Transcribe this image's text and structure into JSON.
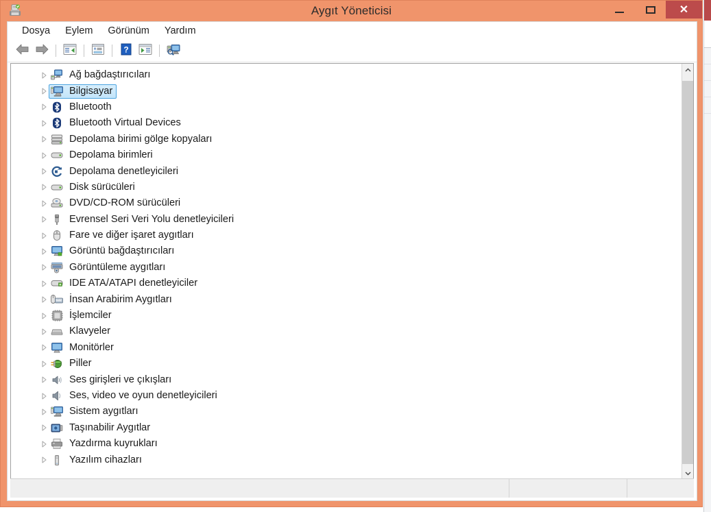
{
  "window": {
    "title": "Aygıt Yöneticisi",
    "app_icon": "device-manager-icon",
    "frame_color": "#f0946b",
    "close_button_color": "#bc4b4b",
    "controls": {
      "minimize_label": "—",
      "maximize_label": "❐",
      "close_label": "✕"
    }
  },
  "menu": {
    "items": [
      {
        "label": "Dosya",
        "name": "menu-dosya"
      },
      {
        "label": "Eylem",
        "name": "menu-eylem"
      },
      {
        "label": "Görünüm",
        "name": "menu-gorunum"
      },
      {
        "label": "Yardım",
        "name": "menu-yardim"
      }
    ]
  },
  "toolbar": {
    "buttons": [
      {
        "icon": "back-arrow-icon"
      },
      {
        "icon": "forward-arrow-icon"
      },
      {
        "icon": "show-hide-console-tree-icon"
      },
      {
        "icon": "properties-icon"
      },
      {
        "icon": "help-icon"
      },
      {
        "icon": "update-driver-icon"
      },
      {
        "icon": "scan-for-hardware-changes-icon"
      }
    ]
  },
  "tree": {
    "selected_index": 1,
    "selection_fill": "#c8e6fa",
    "selection_border": "#4aa3df",
    "items": [
      {
        "label": "Ağ bağdaştırıcıları",
        "icon": "network-adapter-icon"
      },
      {
        "label": "Bilgisayar",
        "icon": "computer-icon"
      },
      {
        "label": "Bluetooth",
        "icon": "bluetooth-icon"
      },
      {
        "label": "Bluetooth Virtual Devices",
        "icon": "bluetooth-icon"
      },
      {
        "label": "Depolama birimi gölge kopyaları",
        "icon": "storage-volume-shadow-copy-icon"
      },
      {
        "label": "Depolama birimleri",
        "icon": "storage-volume-icon"
      },
      {
        "label": "Depolama denetleyicileri",
        "icon": "storage-controller-icon"
      },
      {
        "label": "Disk sürücüleri",
        "icon": "disk-drive-icon"
      },
      {
        "label": "DVD/CD-ROM sürücüleri",
        "icon": "dvd-cdrom-drive-icon"
      },
      {
        "label": "Evrensel Seri Veri Yolu denetleyicileri",
        "icon": "usb-controller-icon"
      },
      {
        "label": "Fare ve diğer işaret aygıtları",
        "icon": "mouse-icon"
      },
      {
        "label": "Görüntü bağdaştırıcıları",
        "icon": "display-adapter-icon"
      },
      {
        "label": "Görüntüleme aygıtları",
        "icon": "imaging-device-icon"
      },
      {
        "label": "IDE ATA/ATAPI denetleyiciler",
        "icon": "ide-controller-icon"
      },
      {
        "label": "İnsan Arabirim Aygıtları",
        "icon": "human-interface-device-icon"
      },
      {
        "label": "İşlemciler",
        "icon": "processor-icon"
      },
      {
        "label": "Klavyeler",
        "icon": "keyboard-icon"
      },
      {
        "label": "Monitörler",
        "icon": "monitor-icon"
      },
      {
        "label": "Piller",
        "icon": "battery-icon"
      },
      {
        "label": "Ses girişleri ve çıkışları",
        "icon": "audio-input-output-icon"
      },
      {
        "label": "Ses, video ve oyun denetleyicileri",
        "icon": "sound-video-game-controller-icon"
      },
      {
        "label": "Sistem aygıtları",
        "icon": "system-device-icon"
      },
      {
        "label": "Taşınabilir Aygıtlar",
        "icon": "portable-device-icon"
      },
      {
        "label": "Yazdırma kuyrukları",
        "icon": "print-queue-icon"
      },
      {
        "label": "Yazılım cihazları",
        "icon": "software-device-icon"
      }
    ]
  },
  "scrollbar": {
    "up_arrow": "chevron-up-icon",
    "down_arrow": "chevron-down-icon"
  },
  "status_bar": {
    "pane_main": "",
    "pane_2": "",
    "pane_3": ""
  }
}
